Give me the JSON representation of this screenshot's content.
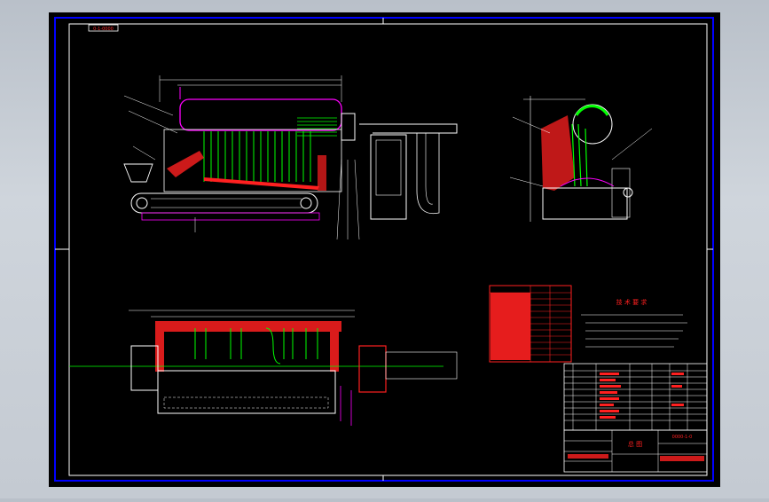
{
  "drawing": {
    "stamp": "0-1-0000",
    "colors": {
      "background": "#000000",
      "border": "#0000ff",
      "frame": "#ffffff",
      "structure": "#ff00ff",
      "fill_red": "#ff2020",
      "tubes": "#00ff00",
      "labels": "#ffff00",
      "dims": "#ffffff",
      "cyan": "#00ffff"
    },
    "tech_requirements_title": "技 术 要 求",
    "title_block_center": "总 图",
    "title_block_code": "0000-1-0",
    "parts_rows": 10,
    "param_rows": 12
  }
}
